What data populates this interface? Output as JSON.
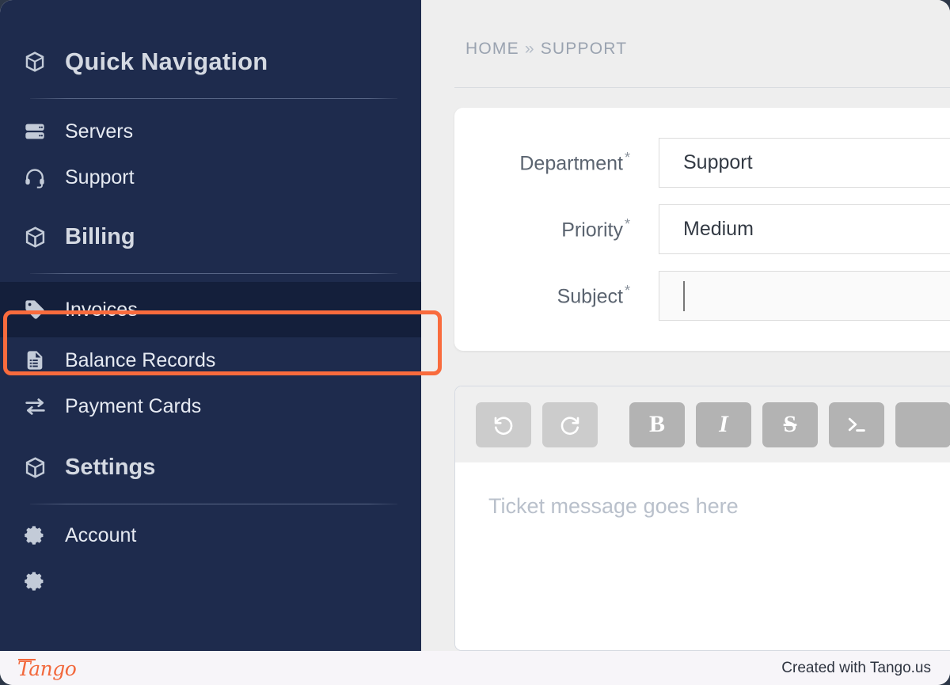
{
  "sidebar": {
    "brand": {
      "label": "Quick Navigation",
      "icon": "cube-icon"
    },
    "groups": [
      {
        "items": [
          {
            "label": "Servers",
            "icon": "server-icon",
            "style": "normal",
            "highlighted": false
          },
          {
            "label": "Support",
            "icon": "headset-icon",
            "style": "normal",
            "highlighted": false
          },
          {
            "label": "Billing",
            "icon": "cube-icon",
            "style": "big",
            "highlighted": false
          }
        ]
      },
      {
        "items": [
          {
            "label": "Invoices",
            "icon": "tag-icon",
            "style": "normal",
            "highlighted": true
          },
          {
            "label": "Balance Records",
            "icon": "document-icon",
            "style": "normal",
            "highlighted": false
          },
          {
            "label": "Payment Cards",
            "icon": "transfer-icon",
            "style": "normal",
            "highlighted": false
          },
          {
            "label": "Settings",
            "icon": "cube-icon",
            "style": "big",
            "highlighted": false
          }
        ]
      },
      {
        "items": [
          {
            "label": "Account",
            "icon": "gear-icon",
            "style": "normal",
            "highlighted": false
          }
        ]
      }
    ]
  },
  "breadcrumb": {
    "home": "HOME",
    "separator": "»",
    "current": "SUPPORT"
  },
  "form": {
    "fields": [
      {
        "label": "Department",
        "required": "*",
        "value": "Support",
        "type": "select"
      },
      {
        "label": "Priority",
        "required": "*",
        "value": "Medium",
        "type": "select"
      },
      {
        "label": "Subject",
        "required": "*",
        "value": "",
        "type": "text",
        "focused": true
      }
    ]
  },
  "editor": {
    "toolbar": [
      {
        "name": "undo-button",
        "glyph": "undo-icon",
        "state": "muted"
      },
      {
        "name": "redo-button",
        "glyph": "redo-icon",
        "state": "muted"
      },
      {
        "name": "bold-button",
        "glyph": "B",
        "state": "active"
      },
      {
        "name": "italic-button",
        "glyph": "I",
        "state": "active"
      },
      {
        "name": "strikethrough-button",
        "glyph": "S",
        "state": "active"
      },
      {
        "name": "code-button",
        "glyph": "terminal-icon",
        "state": "active"
      },
      {
        "name": "more-button",
        "glyph": "",
        "state": "active"
      }
    ],
    "placeholder": "Ticket message goes here"
  },
  "footer": {
    "logo": "Tango",
    "note": "Created with Tango.us"
  },
  "colors": {
    "sidebar_navy": "#1e2b4d",
    "highlight_orange": "#f96b3d",
    "selected_navy": "#141f3b",
    "tango_orange": "#f2683c"
  }
}
